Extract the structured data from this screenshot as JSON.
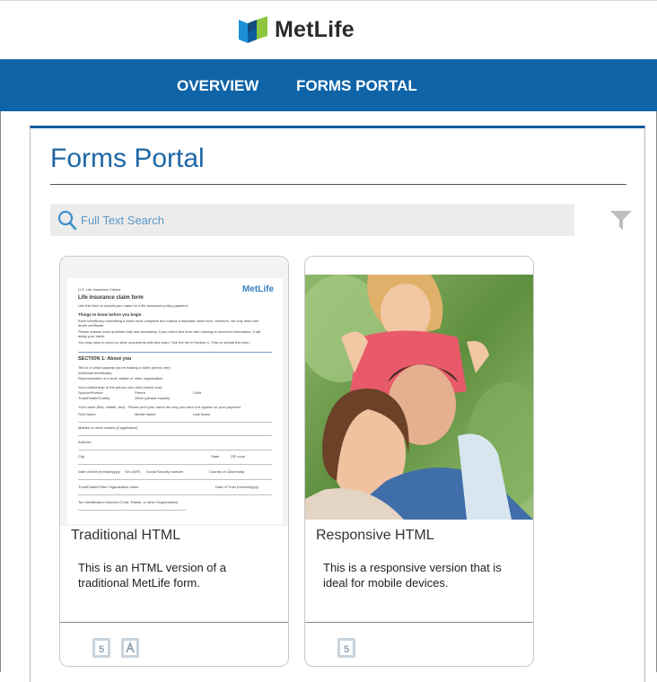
{
  "brand": {
    "name": "MetLife",
    "colors": {
      "nav": "#0f64a8",
      "title": "#1f67a5",
      "panel_top": "#0f5b9e"
    }
  },
  "nav": {
    "items": [
      {
        "label": "OVERVIEW"
      },
      {
        "label": "FORMS PORTAL"
      }
    ]
  },
  "page": {
    "title": "Forms Portal"
  },
  "search": {
    "placeholder": "Full Text Search",
    "value": ""
  },
  "cards": [
    {
      "title": "Traditional HTML",
      "description": "This is an HTML version of a traditional MetLife form.",
      "icons": [
        "html5-icon",
        "pdf-icon"
      ],
      "thumbnail": {
        "logo": "MetLife",
        "header": "U.S. Life Insurance Claims",
        "form_title": "Life insurance claim form",
        "form_subtitle": "Use this form to submit your claim for a life insurance policy payment.",
        "things_heading": "Things to know before you begin",
        "bullets": [
          "Each beneficiary submitting a claim must complete and submit a separate claim form. However, we only need one death certificate.",
          "Please answer each question fully and accurately. If you return this form with missing or incorrect information, it will delay your claim.",
          "You may have to send us other documents with this claim. See the list in Section 4, 'How to submit this form.'"
        ],
        "section_heading": "SECTION 1: About you",
        "capacity_prompt": "Tell us in what capacity you're making a claim (check one):",
        "capacity_options": [
          "Individual beneficiary",
          "Representative of a trust, estate or other organization"
        ],
        "relationship_prompt": "Your relationship to the person who died (check one):",
        "relationship_options": [
          "Spouse/Partner",
          "Parent",
          "Child",
          "Trust/Estate/Charity",
          "Other (please explain)"
        ],
        "name_prompt": "Your name (first, middle, last) - Please print your name the way you want it to appear on your payment",
        "fields": [
          "First Name",
          "Middle Name",
          "Last Name",
          "Maiden or other names (if applicable)",
          "Address",
          "City",
          "State",
          "ZIP code",
          "Date of birth (mm/dd/yyyy)",
          "Sex (M/F)",
          "Social Security number",
          "Country of Citizenship",
          "Trust/Estate/Other Organization name",
          "Date of Trust (mm/dd/yyyy)",
          "Tax Identification Number (Trust, Estate, or other Organization)"
        ]
      }
    },
    {
      "title": "Responsive HTML",
      "description": "This is a responsive version that is ideal for mobile devices.",
      "icons": [
        "html5-icon"
      ]
    }
  ]
}
